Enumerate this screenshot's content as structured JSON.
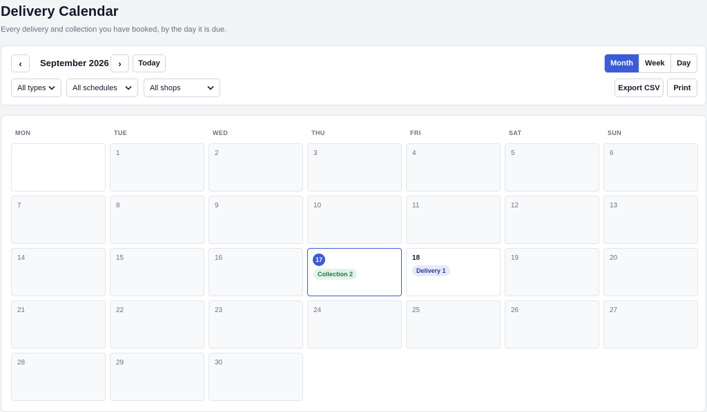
{
  "page": {
    "title": "Delivery Calendar",
    "subtitle": "Every delivery and collection you have booked, by the day it is due."
  },
  "toolbar": {
    "prev_label": "‹",
    "next_label": "›",
    "month_label": "September 2026",
    "today_label": "Today",
    "filters": [
      {
        "selected": "All types"
      },
      {
        "selected": "All schedules"
      },
      {
        "selected": "All shops"
      }
    ],
    "views": [
      {
        "label": "Month",
        "active": true
      },
      {
        "label": "Week",
        "active": false
      },
      {
        "label": "Day",
        "active": false
      }
    ],
    "export_label": "Export CSV",
    "print_label": "Print"
  },
  "colors": {
    "accent": "#3b5bdb",
    "collection_bg": "#e3f3e8",
    "collection_text": "#1f7a43",
    "delivery_bg": "#e4e9fb",
    "delivery_text": "#2d3a8c"
  },
  "calendar": {
    "weekdays": [
      "MON",
      "TUE",
      "WED",
      "THU",
      "FRI",
      "SAT",
      "SUN"
    ],
    "first_weekday_offset": 1,
    "days_in_month": 30,
    "today": 17,
    "events": [
      {
        "day": 17,
        "label": "Collection 2",
        "kind": "collection"
      },
      {
        "day": 18,
        "label": "Delivery 1",
        "kind": "delivery"
      }
    ]
  }
}
